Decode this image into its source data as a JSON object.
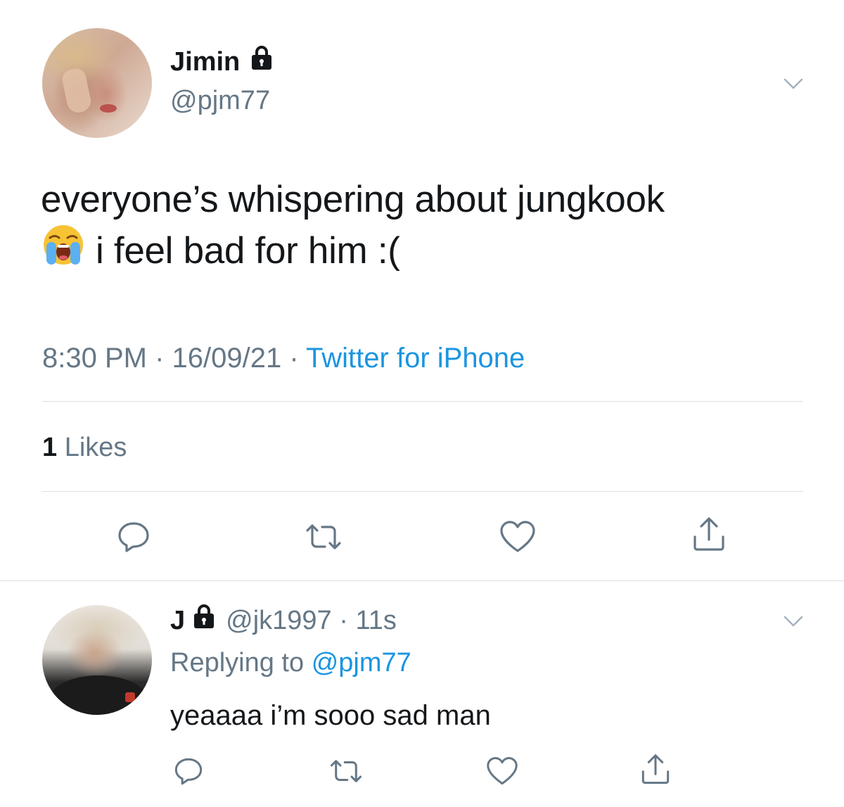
{
  "colors": {
    "text": "#14171a",
    "secondary": "#657786",
    "link": "#1b95e0",
    "divider": "#dddfe2",
    "icon": "#657786"
  },
  "tweet": {
    "display_name": "Jimin",
    "handle": "@pjm77",
    "protected_icon": "lock-icon",
    "text_line1": "everyone’s whispering about jungkook",
    "emoji": "loudly-crying-face-emoji",
    "text_line2": "i feel bad for him :(",
    "time": "8:30 PM",
    "date": "16/09/21",
    "separator": " · ",
    "source": "Twitter for iPhone",
    "likes_count": "1",
    "likes_label": "Likes",
    "actions": [
      "reply-icon",
      "retweet-icon",
      "like-icon",
      "share-icon"
    ]
  },
  "reply": {
    "display_name": "J",
    "protected_icon": "lock-icon",
    "handle": "@jk1997",
    "time": "11s",
    "separator": " · ",
    "replying_prefix": "Replying to",
    "replying_to": "@pjm77",
    "text": "yeaaaa i’m sooo sad man",
    "actions": [
      "reply-icon",
      "retweet-icon",
      "like-icon",
      "share-icon"
    ]
  }
}
